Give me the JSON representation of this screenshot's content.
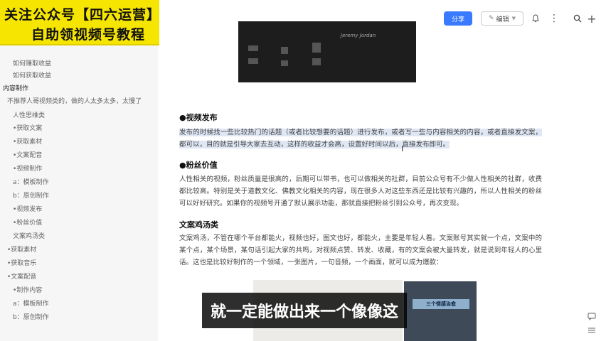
{
  "watermark": {
    "line1": "关注公众号【四六运营】",
    "line2": "自助领视频号教程"
  },
  "sidebar": {
    "items": [
      {
        "label": "如何赚取收益"
      },
      {
        "label": "如何获取收益"
      },
      {
        "label": "内容制作"
      },
      {
        "label": "不推荐人哥视频类的，做的人太多太多，太慢了"
      },
      {
        "label": "人性思维类"
      },
      {
        "label": "•获取文案"
      },
      {
        "label": "•获取素材"
      },
      {
        "label": "•文案配音"
      },
      {
        "label": "•视频制作"
      },
      {
        "label": "a：模板制作"
      },
      {
        "label": "b：原创制作"
      },
      {
        "label": "•视频发布"
      },
      {
        "label": "•粉丝价值"
      },
      {
        "label": "文案鸡汤类"
      },
      {
        "label": "•获取素材"
      },
      {
        "label": "•获取音乐"
      },
      {
        "label": "•文案配音"
      },
      {
        "label": "•制作内容"
      },
      {
        "label": "a：模板制作"
      },
      {
        "label": "b：原创制作"
      }
    ]
  },
  "toolbar": {
    "share_label": "分享",
    "edit_label": "编辑",
    "bell_icon": "bell-icon",
    "menu_icon": "more-icon",
    "search_icon": "search-icon",
    "plus_icon": "plus-icon"
  },
  "document": {
    "image_caption": "Jeremy Jordan",
    "section1_title": "●视频发布",
    "section1_body": "发布的时候找一些比较热门的话题（或者比较想要的话题）进行发布，或者写一些与内容相关的内容，或者直接发文案，都可以，目的就是引导大家去互动，这样的收益才会高，设置好时间以后，直接发布即可。",
    "section2_title": "●粉丝价值",
    "section2_body": "人性相关的视频，粉丝质量是很高的，后期可以带书，也可以做相关的社群，目前公众号有不少做人性相关的社群，收费都比较高。特别是关于道教文化、佛教文化相关的内容，现在很多人对这些东西还是比较有兴趣的，所以人性相关的粉丝可以好好研究。如果你的视频号开通了默认展示功能，那就直接把粉丝引到公众号，再次变现。",
    "section3_title": "文案鸡汤类",
    "section3_body": "文案鸡汤，不管在哪个平台都能火，视频也好，图文也好，都能火，主要是年轻人看。文案账号其实就一个点，文案中的某个点，某个场景，某句话引起大家的共鸣，对视频点赞、转发、收藏，有的文案会被大量转发，就是说到年轻人的心里话。这也是比较好制作的一个领域，一张图片，一句音频，一个画面，就可以成为爆款：",
    "image3_banner": "三个情感治愈"
  },
  "subtitle": "就一定能做出来一个像像这",
  "right_icons": {
    "comment_icon": "comment-icon",
    "list_icon": "list-icon"
  }
}
